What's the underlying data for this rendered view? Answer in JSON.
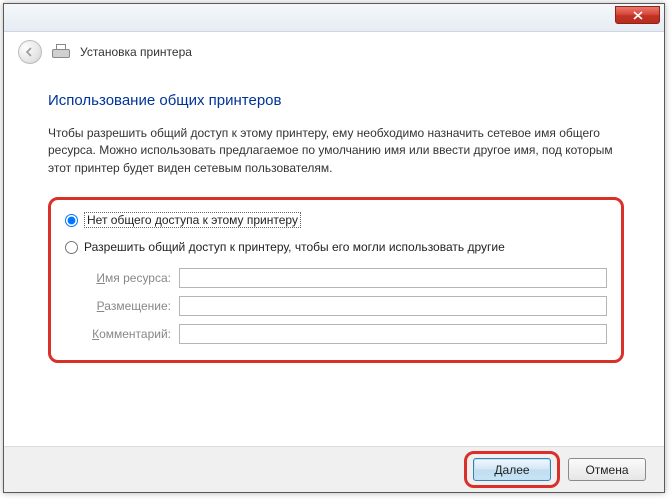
{
  "header": {
    "title": "Установка принтера"
  },
  "main": {
    "heading": "Использование общих принтеров",
    "description": "Чтобы разрешить общий доступ к этому принтеру, ему необходимо назначить сетевое имя общего ресурса. Можно использовать предлагаемое по умолчанию имя или ввести другое имя, под которым этот принтер будет виден сетевым пользователям.",
    "options": {
      "no_share": "Нет общего доступа к этому принтеру",
      "share": "Разрешить общий доступ к принтеру, чтобы его могли использовать другие"
    },
    "fields": {
      "share_name": {
        "underline": "И",
        "rest": "мя ресурса:",
        "value": ""
      },
      "location": {
        "underline": "Р",
        "rest": "азмещение:",
        "value": ""
      },
      "comment": {
        "underline": "К",
        "rest": "омментарий:",
        "value": ""
      }
    }
  },
  "footer": {
    "next": "Далее",
    "cancel": "Отмена"
  }
}
